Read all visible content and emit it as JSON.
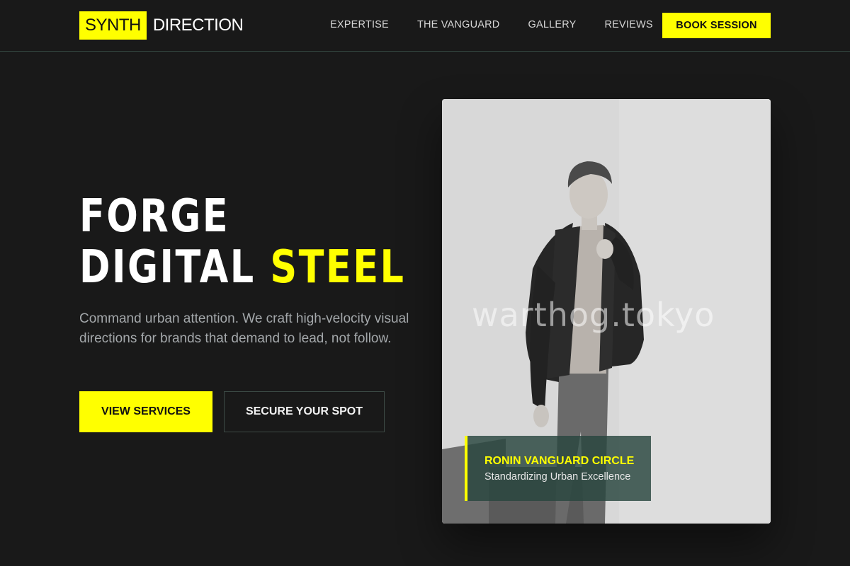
{
  "brand": {
    "part1": "SYNTH",
    "part2": "DIRECTION"
  },
  "nav": {
    "items": [
      {
        "label": "EXPERTISE"
      },
      {
        "label": "THE VANGUARD"
      },
      {
        "label": "GALLERY"
      },
      {
        "label": "REVIEWS"
      }
    ],
    "cta": "BOOK SESSION"
  },
  "hero": {
    "line1": "FORGE",
    "line2a": "DIGITAL",
    "line2b": "STEEL",
    "lead": "Command urban attention. We craft high-velocity visual directions for brands that demand to lead, not follow.",
    "primary_button": "VIEW SERVICES",
    "secondary_button": "SECURE YOUR SPOT"
  },
  "image": {
    "watermark": "warthog.tokyo",
    "caption_title": "RONIN VANGUARD CIRCLE",
    "caption_subtitle": "Standardizing Urban Excellence"
  },
  "colors": {
    "background": "#191919",
    "accent": "#ffff00",
    "caption_bg": "#28463e"
  }
}
